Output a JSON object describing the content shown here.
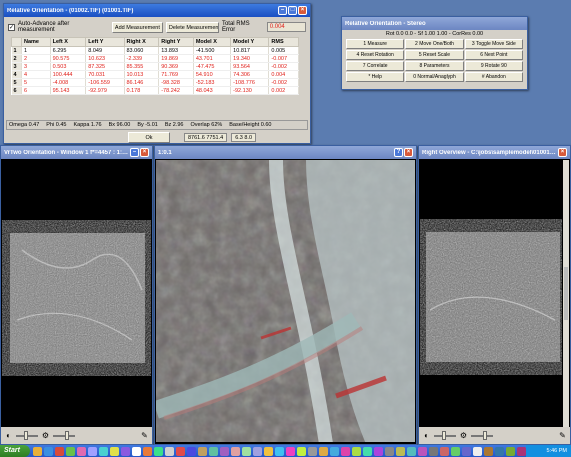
{
  "relative_orientation": {
    "title": "Relative Orientation - (01002.TIF) (01001.TIF)",
    "auto_advance_label": "Auto-Advance after measurement",
    "add_measurement_label": "Add Measurement",
    "delete_measurement_label": "Delete Measurement",
    "total_rms_label": "Total RMS Error",
    "total_rms_value": "0.004",
    "columns": [
      "Name",
      "Left X",
      "Left Y",
      "Right X",
      "Right Y",
      "Model X",
      "Model Y",
      "RMS"
    ],
    "rows": [
      {
        "idx": "1",
        "name": "1",
        "left_x": "6.295",
        "left_y": "8.049",
        "right_x": "83.060",
        "right_y": "13.893",
        "model_x": "-41.500",
        "model_y": "10.817",
        "rms": "0.005",
        "color": "blk"
      },
      {
        "idx": "2",
        "name": "2",
        "left_x": "90.575",
        "left_y": "10.623",
        "right_x": "-2.339",
        "right_y": "19.869",
        "model_x": "43.701",
        "model_y": "19.340",
        "rms": "-0.007",
        "color": "red"
      },
      {
        "idx": "3",
        "name": "3",
        "left_x": "0.503",
        "left_y": "87.325",
        "right_x": "85.355",
        "right_y": "90.369",
        "model_x": "-47.475",
        "model_y": "93.564",
        "rms": "-0.002",
        "color": "red"
      },
      {
        "idx": "4",
        "name": "4",
        "left_x": "100.444",
        "left_y": "70.031",
        "right_x": "10.013",
        "right_y": "71.769",
        "model_x": "54.910",
        "model_y": "74.306",
        "rms": "0.004",
        "color": "red"
      },
      {
        "idx": "5",
        "name": "5",
        "left_x": "-4.008",
        "left_y": "-106.559",
        "right_x": "86.146",
        "right_y": "-98.328",
        "model_x": "-52.183",
        "model_y": "-108.776",
        "rms": "-0.002",
        "color": "red"
      },
      {
        "idx": "6",
        "name": "6",
        "left_x": "95.143",
        "left_y": "-92.979",
        "right_x": "0.178",
        "right_y": "-78.242",
        "model_x": "48.043",
        "model_y": "-92.130",
        "rms": "0.002",
        "color": "red"
      }
    ],
    "status": [
      "Omega 0.47",
      "Phi 0.45",
      "Kappa 1.76",
      "Bx 96.00",
      "By -5.01",
      "Bz 2.96",
      "Overlap 62%",
      "Base/Height 0.60"
    ],
    "ok_label": "Ok",
    "field_a": "8761.6  7751.4",
    "field_b": "6.3  8.0"
  },
  "stereo": {
    "title": "Relative Orientation - Stereo",
    "status": "Rot 0.0  0.0  -  Sf 1.00  1.00  -  CorRes 0.00",
    "buttons": [
      "1 Measure",
      "2 Move One/Both",
      "3 Toggle Move Side",
      "4 Reset Rotation",
      "5 Reset Scale",
      "6 Next Point",
      "7 Correlate",
      "8 Parameters",
      "9 Rotate 90",
      "* Help",
      "0 Normal/Anaglyph",
      "# Abandon"
    ]
  },
  "left_window": {
    "title": "VrTwo Orientation - Window 1  f*=4457 : 1:534853..."
  },
  "center_window": {
    "title": "1:0.1"
  },
  "right_window": {
    "title": "Right Overview - C:\\jobs\\samplemodel\\01001.TIF"
  },
  "taskbar": {
    "start_label": "Start",
    "clock": "5:46 PM"
  }
}
